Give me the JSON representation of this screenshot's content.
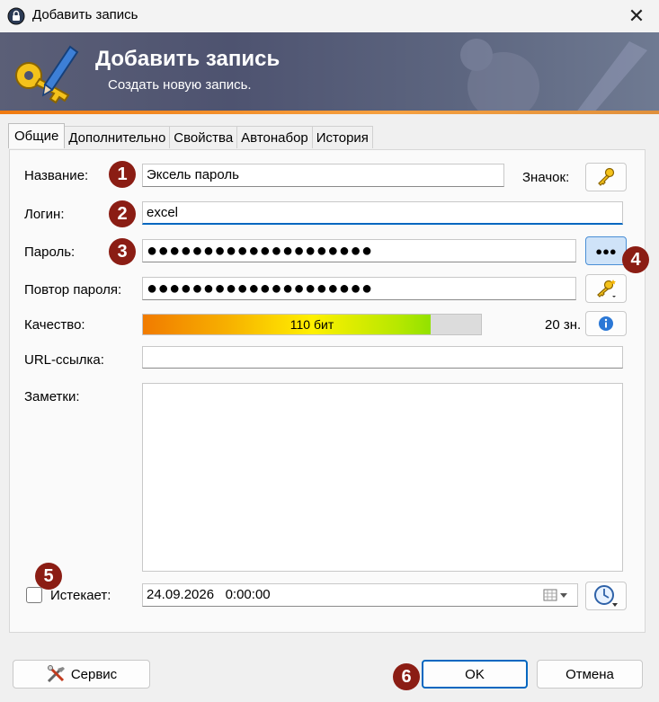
{
  "window": {
    "title": "Добавить запись"
  },
  "banner": {
    "title": "Добавить запись",
    "subtitle": "Создать новую запись."
  },
  "tabs": [
    {
      "label": "Общие",
      "active": true
    },
    {
      "label": "Дополнительно"
    },
    {
      "label": "Свойства"
    },
    {
      "label": "Автонабор"
    },
    {
      "label": "История"
    }
  ],
  "fields": {
    "title_label": "Название:",
    "title_value": "Эксель пароль",
    "icon_label": "Значок:",
    "login_label": "Логин:",
    "login_value": "excel",
    "password_label": "Пароль:",
    "password_value": "●●●●●●●●●●●●●●●●●●●●",
    "repeat_label": "Повтор пароля:",
    "repeat_value": "●●●●●●●●●●●●●●●●●●●●",
    "quality_label": "Качество:",
    "quality_text": "110 бит",
    "quality_fraction": 0.85,
    "char_count": "20 зн.",
    "url_label": "URL-ссылка:",
    "url_value": "",
    "notes_label": "Заметки:",
    "notes_value": "",
    "expires_label": "Истекает:",
    "expires_value": "24.09.2026   0:00:00",
    "expires_checked": false
  },
  "buttons": {
    "show_password": "●●●",
    "tools": "Сервис",
    "ok": "OK",
    "cancel": "Отмена"
  },
  "badges": [
    "1",
    "2",
    "3",
    "4",
    "5",
    "6"
  ]
}
